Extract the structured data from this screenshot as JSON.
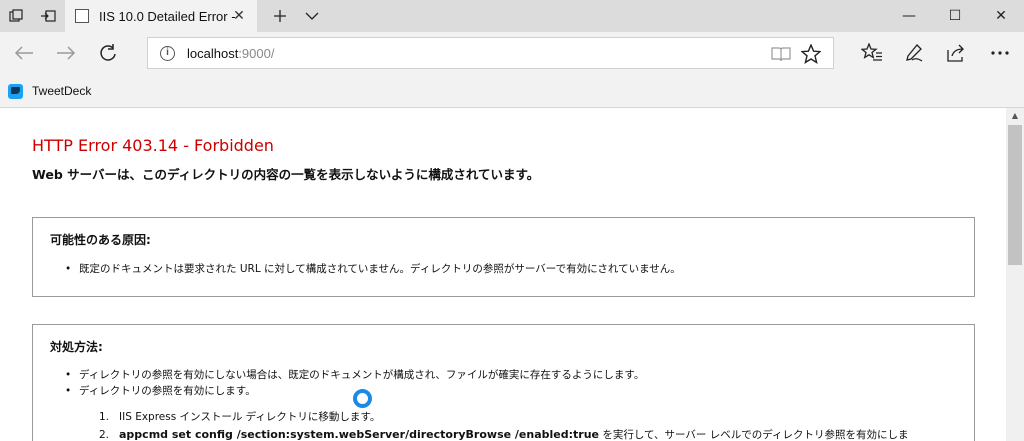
{
  "tabbar": {
    "tab_title": "IIS 10.0 Detailed Error -",
    "icons": [
      "tab-preview-icon",
      "set-aside-tabs-icon",
      "new-tab-icon",
      "tab-list-chevron-icon"
    ]
  },
  "window": {
    "minimize": "—",
    "maximize": "☐",
    "close": "✕"
  },
  "navbar": {
    "url_host": "localhost",
    "url_rest": ":9000/"
  },
  "favorites": {
    "items": [
      {
        "label": "TweetDeck"
      }
    ]
  },
  "page": {
    "title": "HTTP Error 403.14 - Forbidden",
    "subtitle": "Web サーバーは、このディレクトリの内容の一覧を表示しないように構成されています。",
    "causes": {
      "heading": "可能性のある原因:",
      "items": [
        "既定のドキュメントは要求された URL に対して構成されていません。ディレクトリの参照がサーバーで有効にされていません。"
      ]
    },
    "fixes": {
      "heading": "対処方法:",
      "items": [
        "ディレクトリの参照を有効にしない場合は、既定のドキュメントが構成され、ファイルが確実に存在するようにします。",
        "ディレクトリの参照を有効にします。"
      ],
      "steps": [
        {
          "num": "1.",
          "text": "IIS Express インストール ディレクトリに移動します。"
        },
        {
          "num": "2.",
          "cmd": "appcmd set config /section:system.webServer/directoryBrowse /enabled:true",
          "text": " を実行して、サーバー レベルでのディレクトリ参照を有効にしま"
        }
      ]
    }
  },
  "colors": {
    "error_title": "#cc0000",
    "spinner": "#1e88e5"
  }
}
